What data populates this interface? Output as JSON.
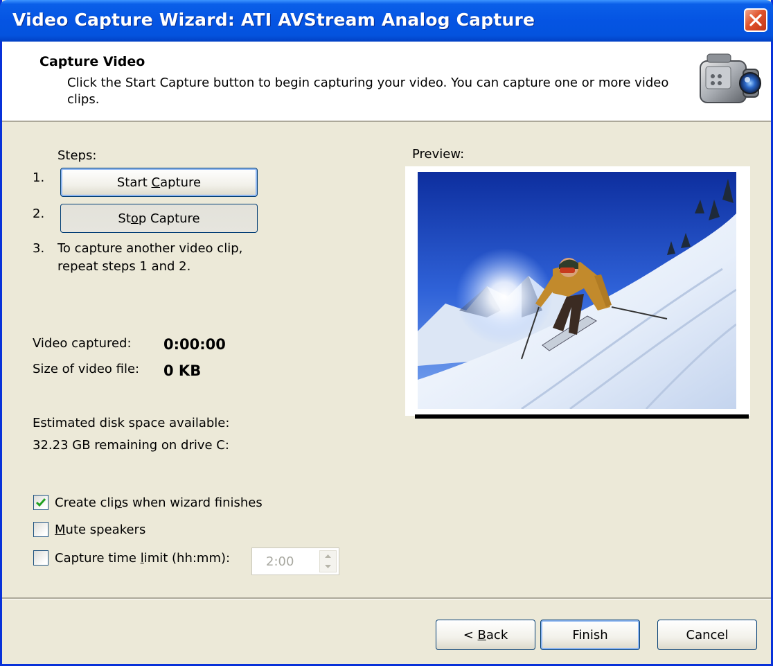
{
  "window": {
    "title": "Video Capture Wizard: ATI AVStream Analog Capture"
  },
  "header": {
    "title": "Capture Video",
    "description": "Click the Start Capture button to begin capturing your video. You can capture one or more video clips."
  },
  "steps": {
    "label": "Steps:",
    "step1_num": "1.",
    "step2_num": "2.",
    "step3_num": "3.",
    "start_before": "Start ",
    "start_mnemonic": "C",
    "start_after": "apture",
    "stop_before": "St",
    "stop_mnemonic": "o",
    "stop_after": "p Capture",
    "step3_line1": "To capture another video clip,",
    "step3_line2": "repeat steps 1 and 2."
  },
  "stats": {
    "video_captured_label": "Video captured:",
    "video_captured_value": "0:00:00",
    "size_label": "Size of video file:",
    "size_value": "0 KB",
    "disk_label": "Estimated disk space available:",
    "disk_value": "32.23 GB remaining on drive C:"
  },
  "options": {
    "create_clips": {
      "before": "Create cli",
      "mnemonic": "p",
      "after": "s when wizard finishes",
      "checked": true
    },
    "mute": {
      "before": "",
      "mnemonic": "M",
      "after": "ute speakers",
      "checked": false
    },
    "time_limit": {
      "before": "Capture time ",
      "mnemonic": "l",
      "after": "imit (hh:mm):",
      "checked": false,
      "value": "2:00"
    }
  },
  "preview": {
    "label": "Preview:"
  },
  "buttons": {
    "back_prefix": "< ",
    "back_mnemonic": "B",
    "back_rest": "ack",
    "finish": "Finish",
    "cancel": "Cancel"
  },
  "colors": {
    "titlebar": "#0554E3",
    "dialog_bg": "#ECE9D8",
    "close_btn": "#E0522B",
    "checkmark": "#21A121"
  }
}
